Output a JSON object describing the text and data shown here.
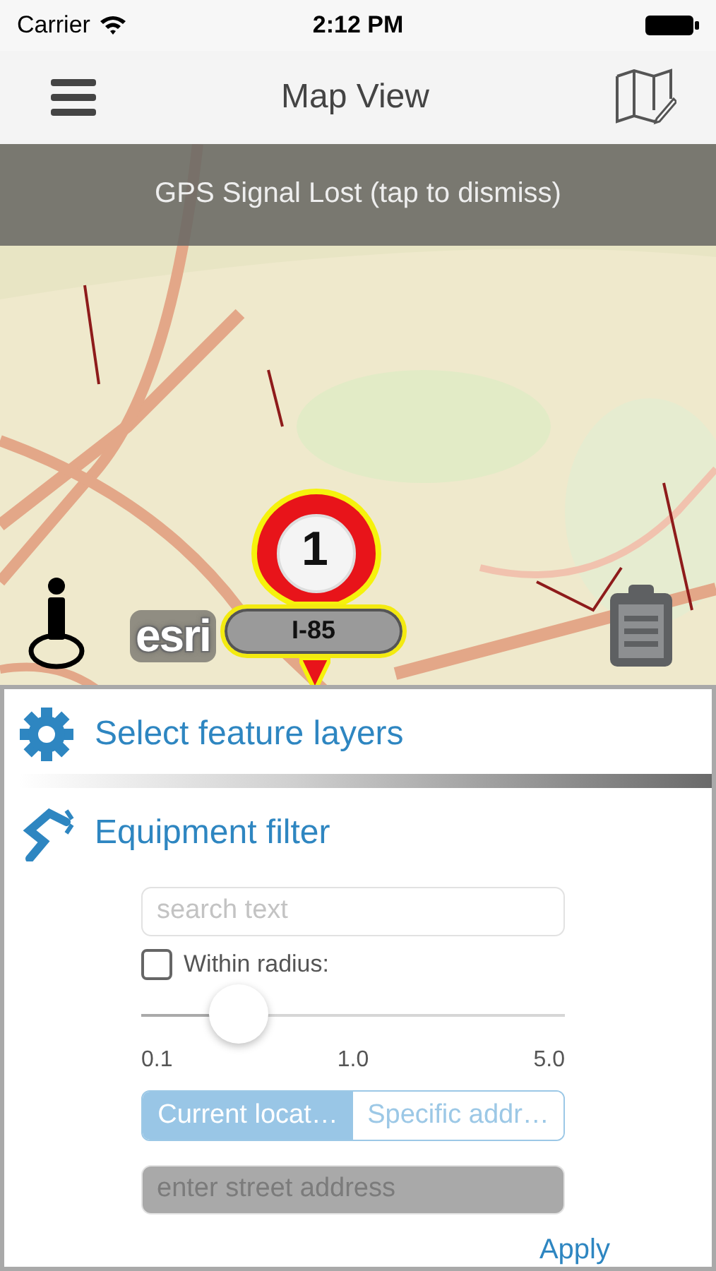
{
  "status_bar": {
    "carrier": "Carrier",
    "time": "2:12 PM"
  },
  "nav_bar": {
    "title": "Map View"
  },
  "banner": {
    "text": "GPS Signal Lost (tap to dismiss)"
  },
  "map": {
    "kind": "picture",
    "attribution": "esri",
    "marker": {
      "count": "1",
      "label": "I-85"
    }
  },
  "panel": {
    "sections": [
      {
        "title": "Select feature layers"
      },
      {
        "title": "Equipment filter"
      }
    ],
    "filter": {
      "search": {
        "placeholder": "search text"
      },
      "within_radius": {
        "label": "Within radius:",
        "checked": false
      },
      "radius": {
        "level": 0.23,
        "ticks": [
          "0.1",
          "1.0",
          "5.0"
        ]
      },
      "location_mode": [
        {
          "label": "Current locat…",
          "selected": true
        },
        {
          "label": "Specific addr…",
          "selected": false
        }
      ],
      "address": {
        "placeholder": "enter street address",
        "disabled": true
      },
      "apply": "Apply"
    }
  }
}
